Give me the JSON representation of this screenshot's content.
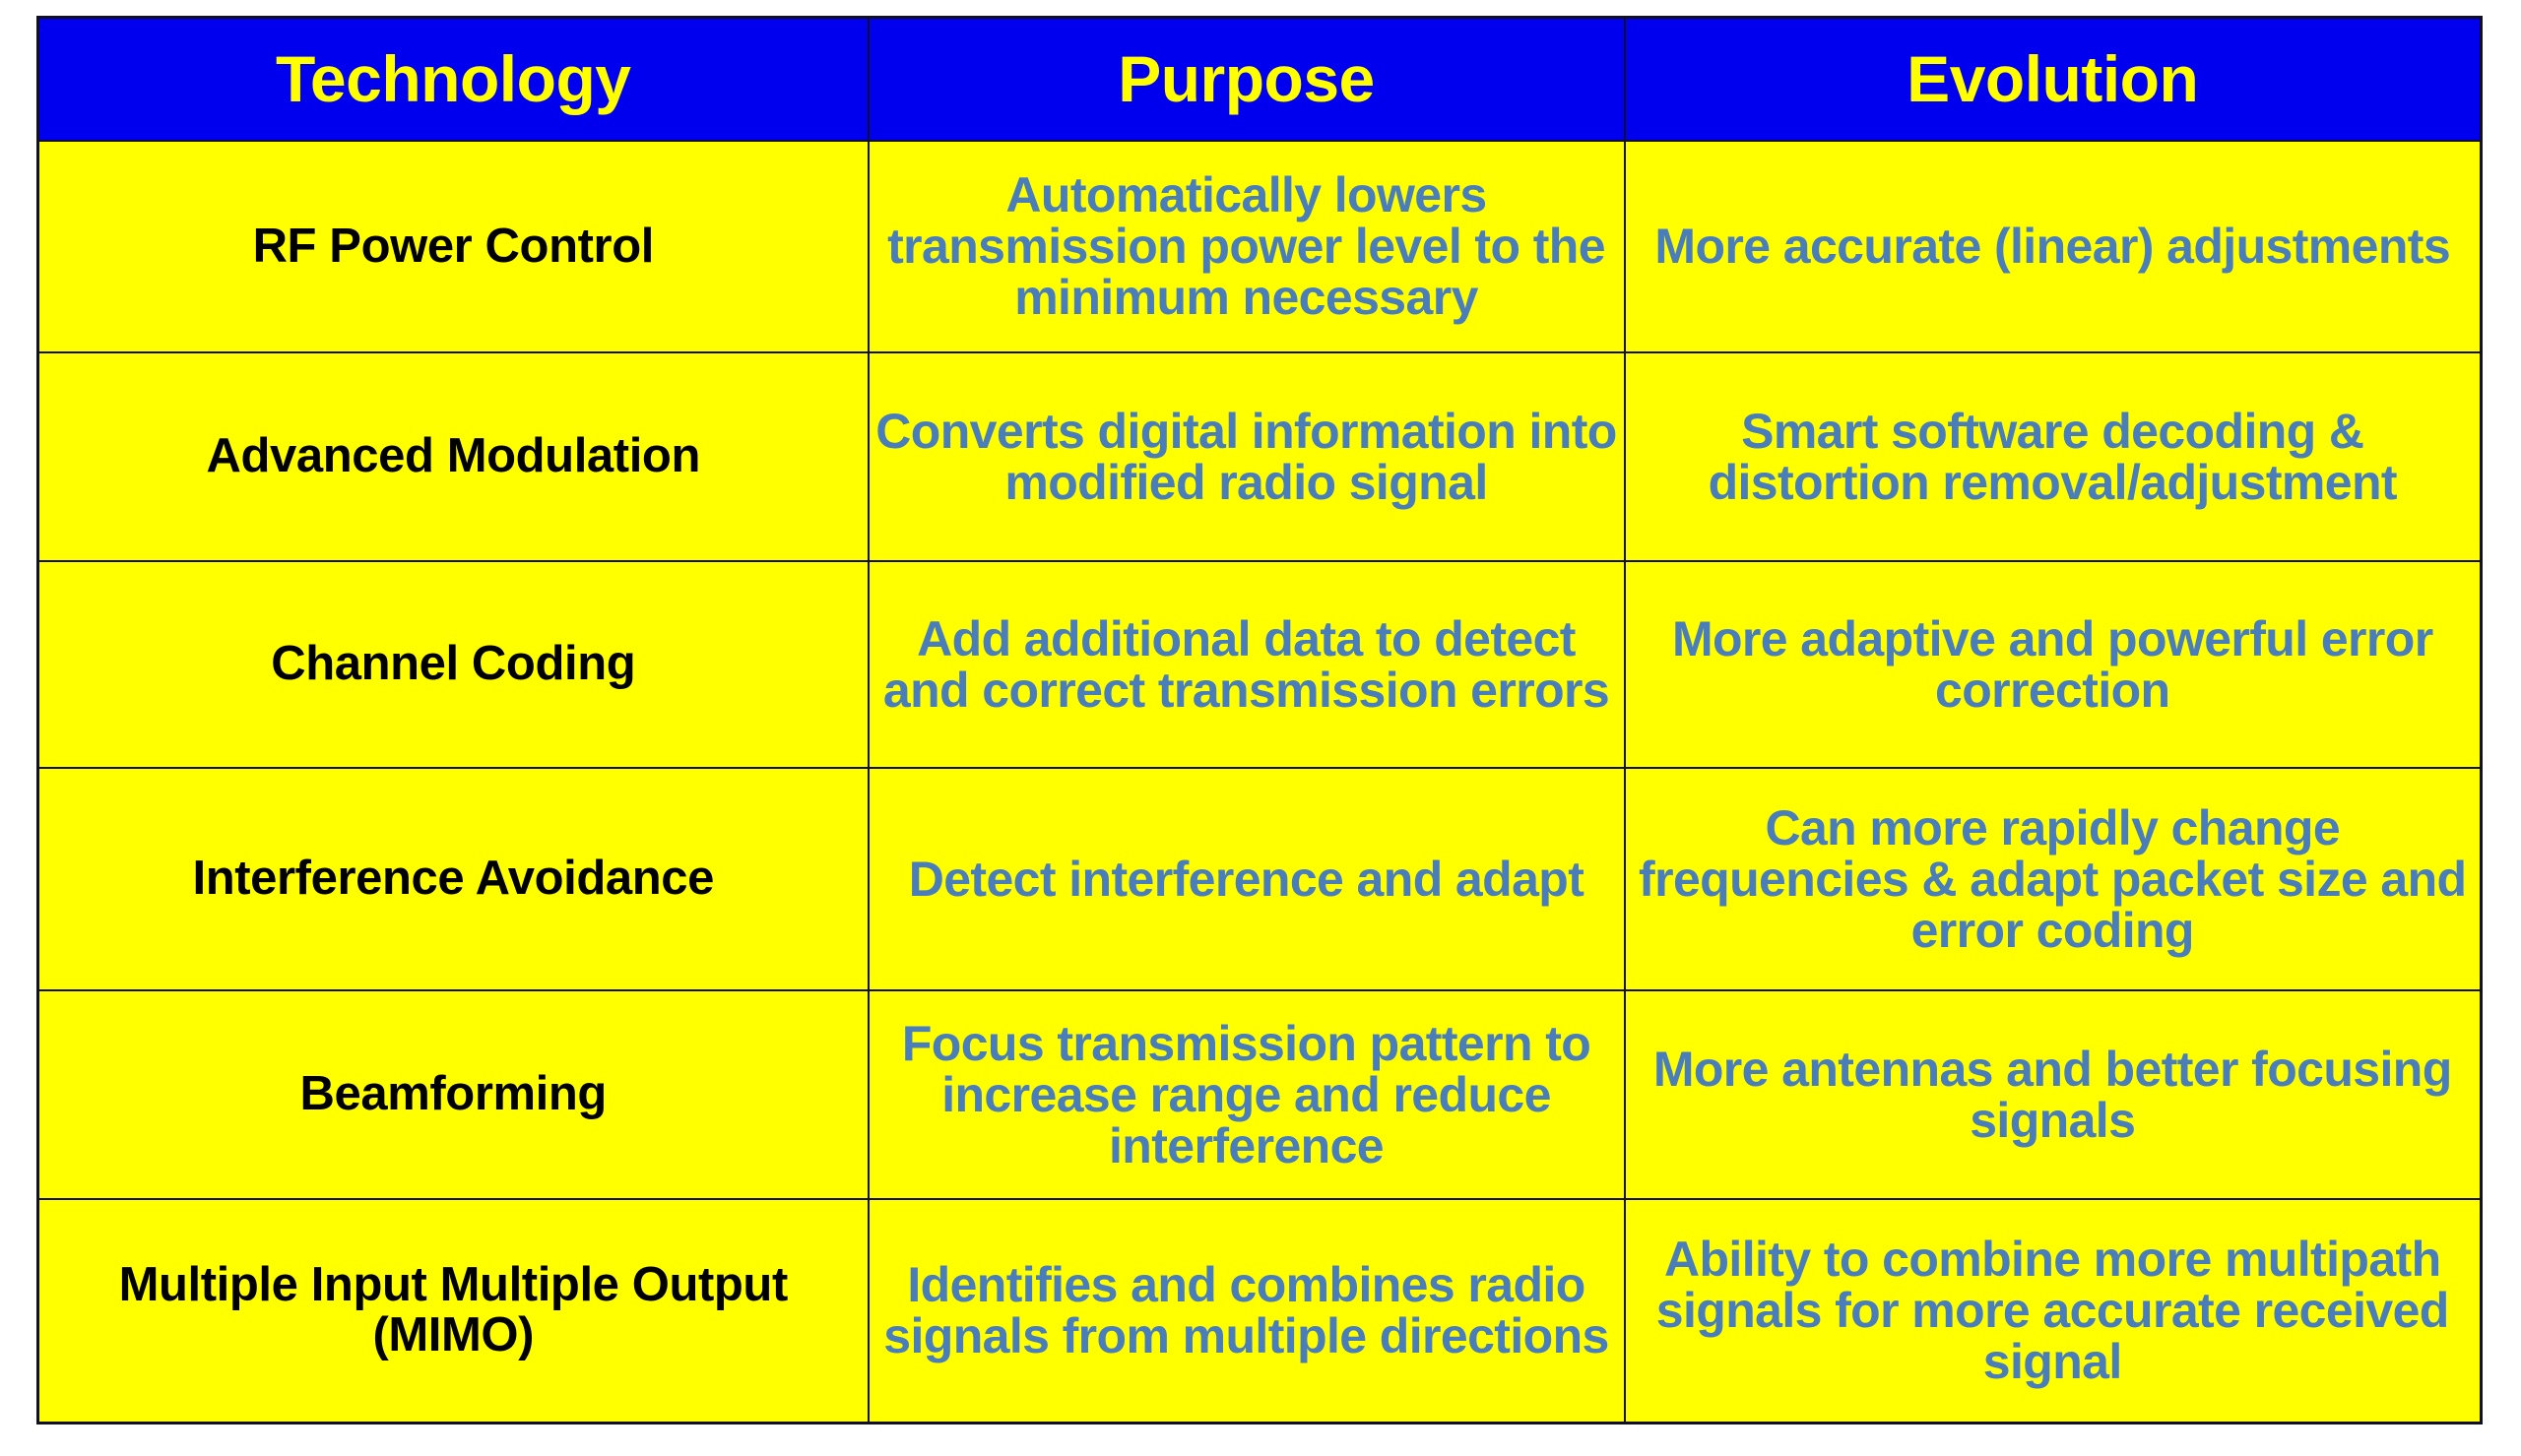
{
  "table": {
    "headers": [
      "Technology",
      "Purpose",
      "Evolution"
    ],
    "colors": {
      "header_background": "#0000ee",
      "header_text": "#ffff00",
      "cell_background": "#ffff00",
      "technology_text": "#000000",
      "description_text": "#4a7ebb",
      "border": "#101020",
      "page_background": "#ffffff"
    },
    "rows": [
      {
        "technology": "RF Power Control",
        "purpose": "Automatically lowers transmission power level to the minimum necessary",
        "evolution": "More accurate (linear) adjustments"
      },
      {
        "technology": "Advanced Modulation",
        "purpose": "Converts digital information into modified radio signal",
        "evolution": "Smart software decoding & distortion removal/adjustment"
      },
      {
        "technology": "Channel Coding",
        "purpose": "Add additional data to detect and correct transmission errors",
        "evolution": "More adaptive and powerful error correction"
      },
      {
        "technology": "Interference Avoidance",
        "purpose": "Detect interference and adapt",
        "evolution": "Can more rapidly change frequencies & adapt packet size and error coding"
      },
      {
        "technology": "Beamforming",
        "purpose": "Focus transmission pattern to increase range and reduce interference",
        "evolution": "More antennas and better focusing signals"
      },
      {
        "technology": "Multiple Input Multiple Output (MIMO)",
        "purpose": "Identifies and combines radio signals from multiple directions",
        "evolution": "Ability to combine more multipath signals for more accurate received signal"
      }
    ]
  }
}
